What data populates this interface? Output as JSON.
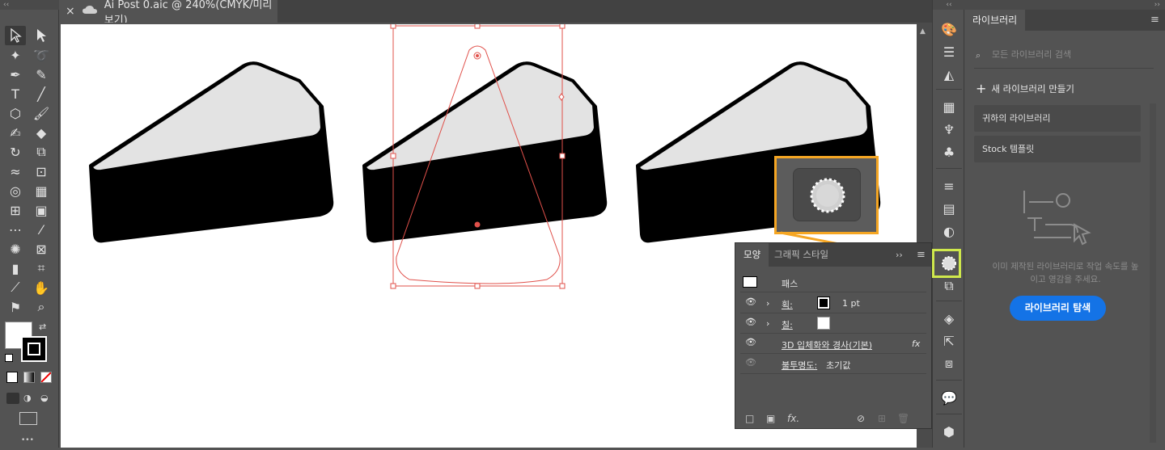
{
  "document_tab": {
    "close": "×",
    "title": "Ai Post 0.aic @ 240%(CMYK/미리 보기)"
  },
  "toolbar": {
    "more": "•••"
  },
  "libraries": {
    "tab": "라이브러리",
    "search_placeholder": "모든 라이브러리 검색",
    "new_library": "새 라이브러리 만들기",
    "rows": [
      "귀하의 라이브러리",
      "Stock 템플릿"
    ],
    "description_line1": "이미 제작된 라이브러리로 작업 속도를 높",
    "description_line2": "이고 영감을 주세요.",
    "explore_button": "라이브러리 탐색"
  },
  "appearance": {
    "tab_active": "모양",
    "tab_other": "그래픽 스타일",
    "object_label": "패스",
    "stroke_label": "획:",
    "stroke_value": "1 pt",
    "fill_label": "칠:",
    "effect_label": "3D 입체화와 경사(기본)",
    "fx": "fx",
    "opacity_label": "불투명도:",
    "opacity_value": "초기값"
  },
  "colors": {
    "accent": "#1473e6",
    "highlight_orange": "#f5a623",
    "highlight_green": "#cfe84c",
    "selection_red": "#e0504a"
  }
}
